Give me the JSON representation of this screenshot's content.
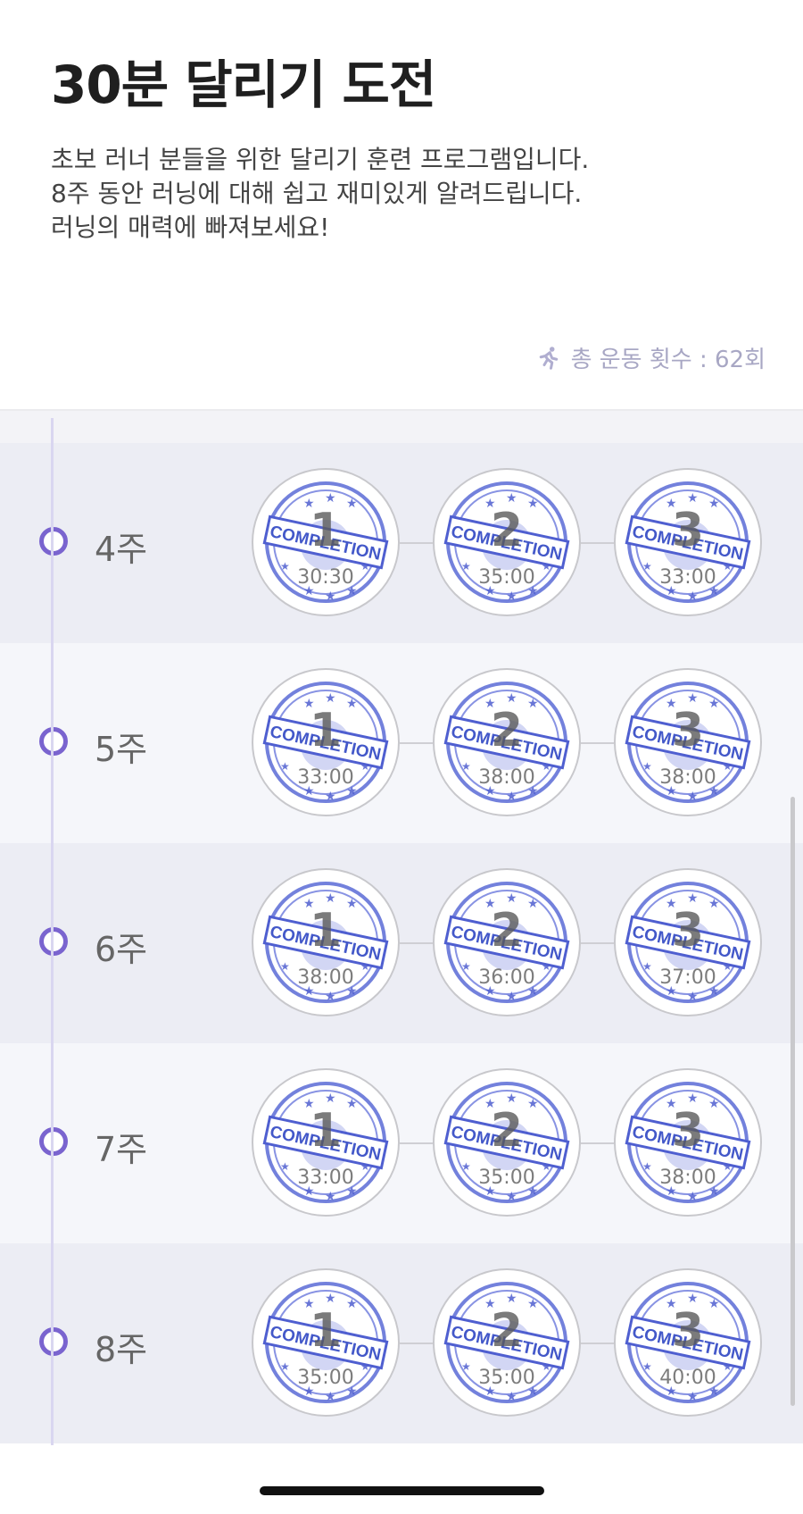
{
  "header": {
    "title": "30분 달리기 도전",
    "description": [
      "초보 러너 분들을 위한 달리기 훈련 프로그램입니다.",
      "8주 동안 러닝에 대해 쉽고 재미있게 알려드립니다.",
      "러닝의 매력에 빠져보세요!"
    ],
    "total_label": "총 운동 횟수 : 62회",
    "total_icon": "running-icon"
  },
  "stamp_text": "COMPLETION",
  "weeks": [
    {
      "label": "4주",
      "sessions": [
        {
          "num": "1",
          "time": "30:30"
        },
        {
          "num": "2",
          "time": "35:00"
        },
        {
          "num": "3",
          "time": "33:00"
        }
      ]
    },
    {
      "label": "5주",
      "sessions": [
        {
          "num": "1",
          "time": "33:00"
        },
        {
          "num": "2",
          "time": "38:00"
        },
        {
          "num": "3",
          "time": "38:00"
        }
      ]
    },
    {
      "label": "6주",
      "sessions": [
        {
          "num": "1",
          "time": "38:00"
        },
        {
          "num": "2",
          "time": "36:00"
        },
        {
          "num": "3",
          "time": "37:00"
        }
      ]
    },
    {
      "label": "7주",
      "sessions": [
        {
          "num": "1",
          "time": "33:00"
        },
        {
          "num": "2",
          "time": "35:00"
        },
        {
          "num": "3",
          "time": "38:00"
        }
      ]
    },
    {
      "label": "8주",
      "sessions": [
        {
          "num": "1",
          "time": "35:00"
        },
        {
          "num": "2",
          "time": "35:00"
        },
        {
          "num": "3",
          "time": "40:00"
        }
      ]
    }
  ]
}
